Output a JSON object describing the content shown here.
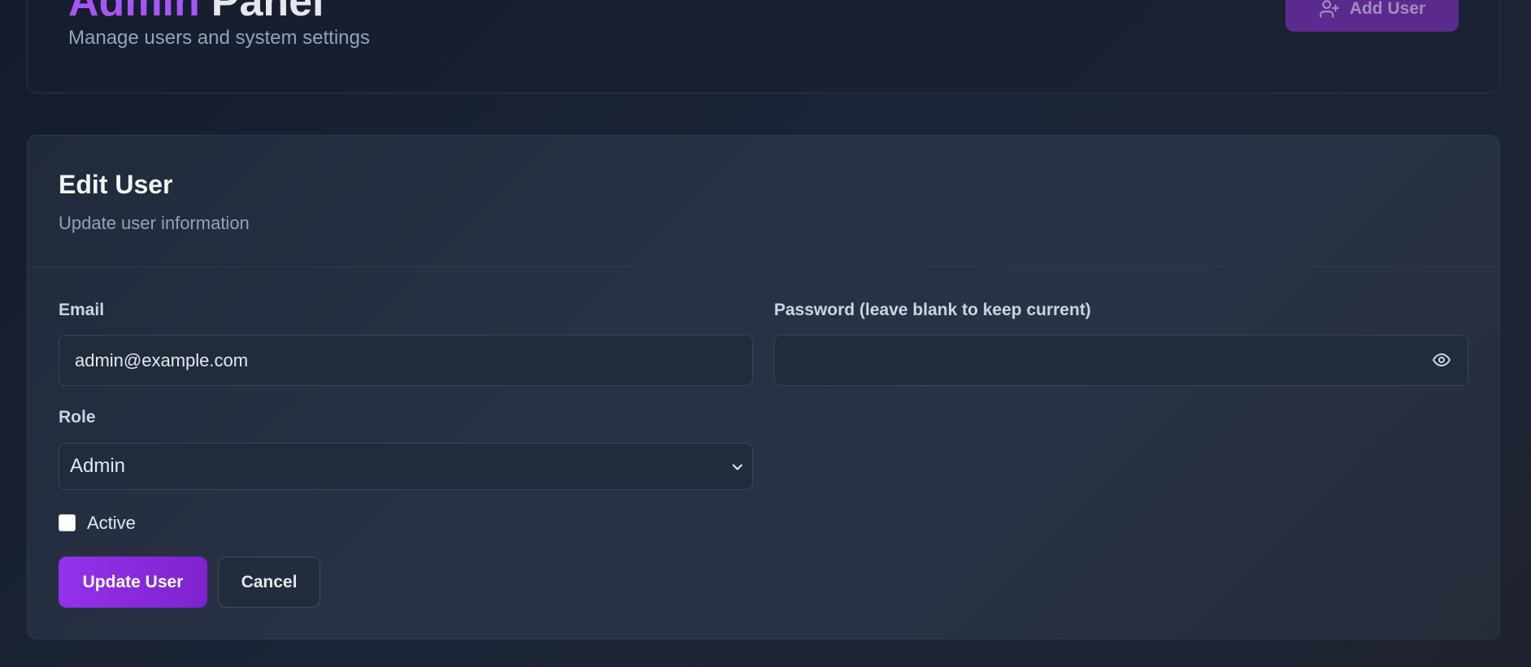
{
  "header": {
    "title_accent": "Admin",
    "title_rest": "Panel",
    "subtitle": "Manage users and system settings",
    "add_user_label": "Add User"
  },
  "edit_user": {
    "title": "Edit User",
    "subtitle": "Update user information",
    "email": {
      "label": "Email",
      "value": "admin@example.com"
    },
    "password": {
      "label": "Password (leave blank to keep current)",
      "value": ""
    },
    "role": {
      "label": "Role",
      "selected": "Admin"
    },
    "active": {
      "label": "Active",
      "checked": false
    },
    "update_label": "Update User",
    "cancel_label": "Cancel"
  },
  "colors": {
    "accent": "#9333ea",
    "background": "#172033",
    "card": "#283244"
  }
}
